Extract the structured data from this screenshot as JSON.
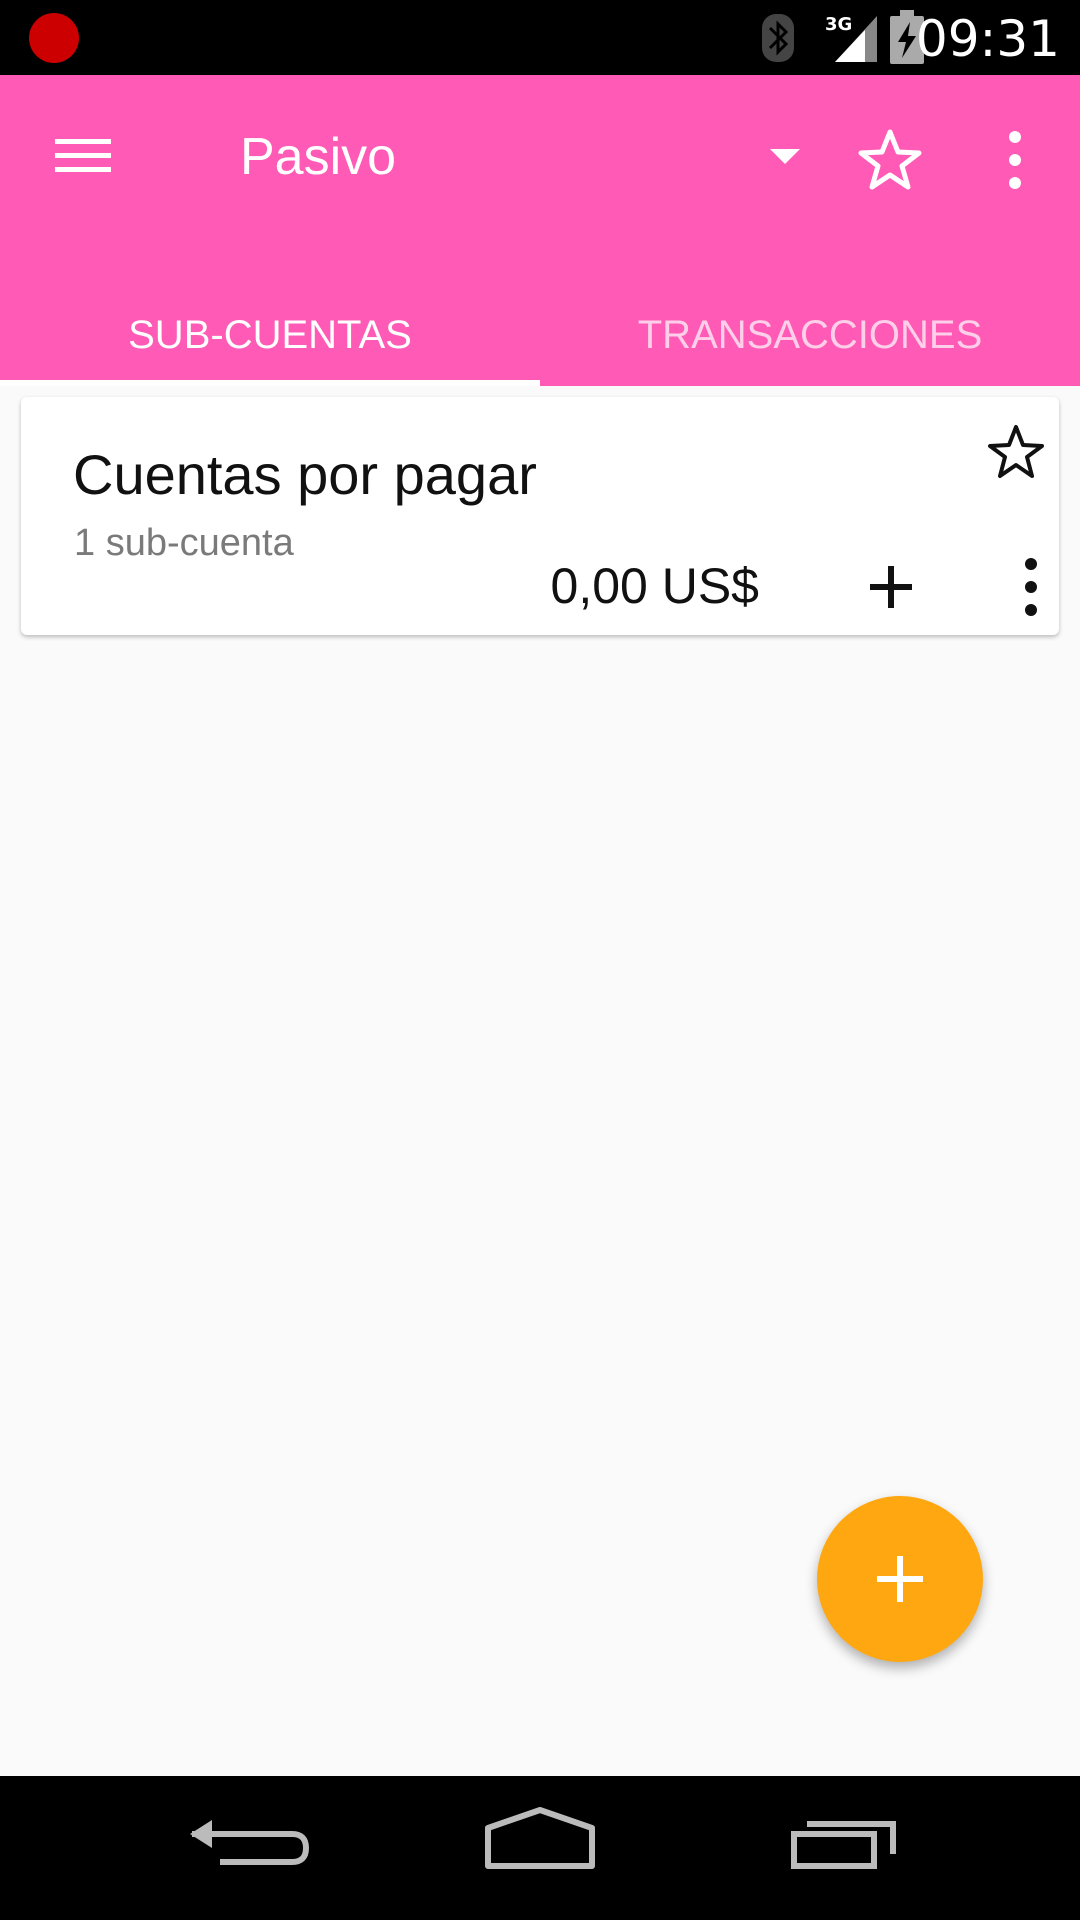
{
  "status_bar": {
    "time": "09:31",
    "network": "3G",
    "icons": [
      "recording-dot-icon",
      "bluetooth-icon",
      "signal-3g-icon",
      "battery-charging-icon"
    ]
  },
  "app_bar": {
    "title": "Pasivo",
    "color": "#ff5bb6",
    "icons": [
      "menu-icon",
      "dropdown-arrow-icon",
      "star-outline-icon",
      "more-vert-icon"
    ]
  },
  "tabs": [
    {
      "label": "SUB-CUENTAS",
      "selected": true
    },
    {
      "label": "TRANSACCIONES",
      "selected": false
    }
  ],
  "accounts": [
    {
      "name": "Cuentas por pagar",
      "subaccounts": "1 sub-cuenta",
      "balance": "0,00 US$",
      "favorite": false
    }
  ],
  "fab": {
    "icon": "add-icon",
    "color": "#ffa710"
  },
  "nav_bar": {
    "icons": [
      "back-icon",
      "home-icon",
      "recents-icon"
    ]
  }
}
